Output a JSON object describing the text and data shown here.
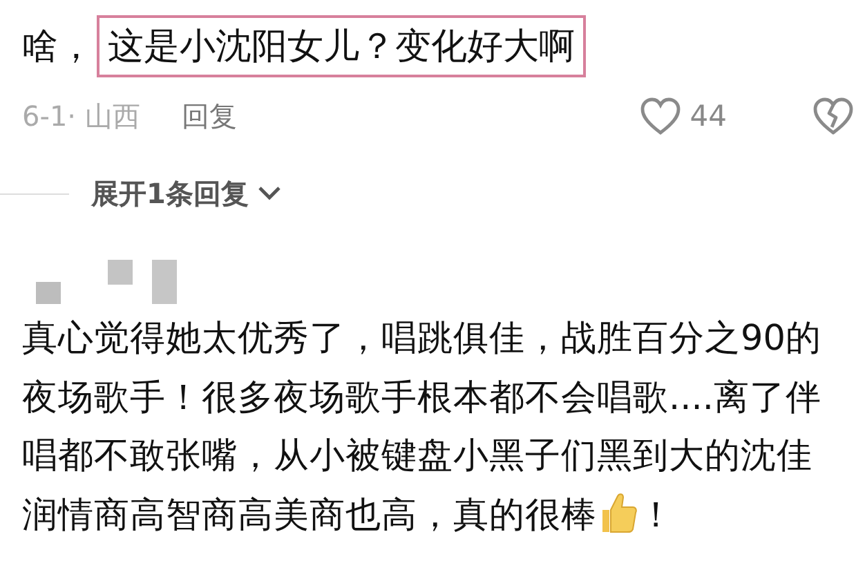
{
  "comment": {
    "prefix": "啥，",
    "highlight": "这是小沈阳女儿？变化好大啊",
    "meta": "6-1· 山西",
    "reply": "回复",
    "likes": "44"
  },
  "expand_replies": {
    "label": "展开1条回复"
  },
  "next_comment": {
    "text": "真心觉得她太优秀了，唱跳俱佳，战胜百分之90的夜场歌手！很多夜场歌手根本都不会唱歌....离了伴唱都不敢张嘴，从小被键盘小黑子们黑到大的沈佳润情商高智商高美商也高，真的很棒",
    "suffix": "！"
  }
}
